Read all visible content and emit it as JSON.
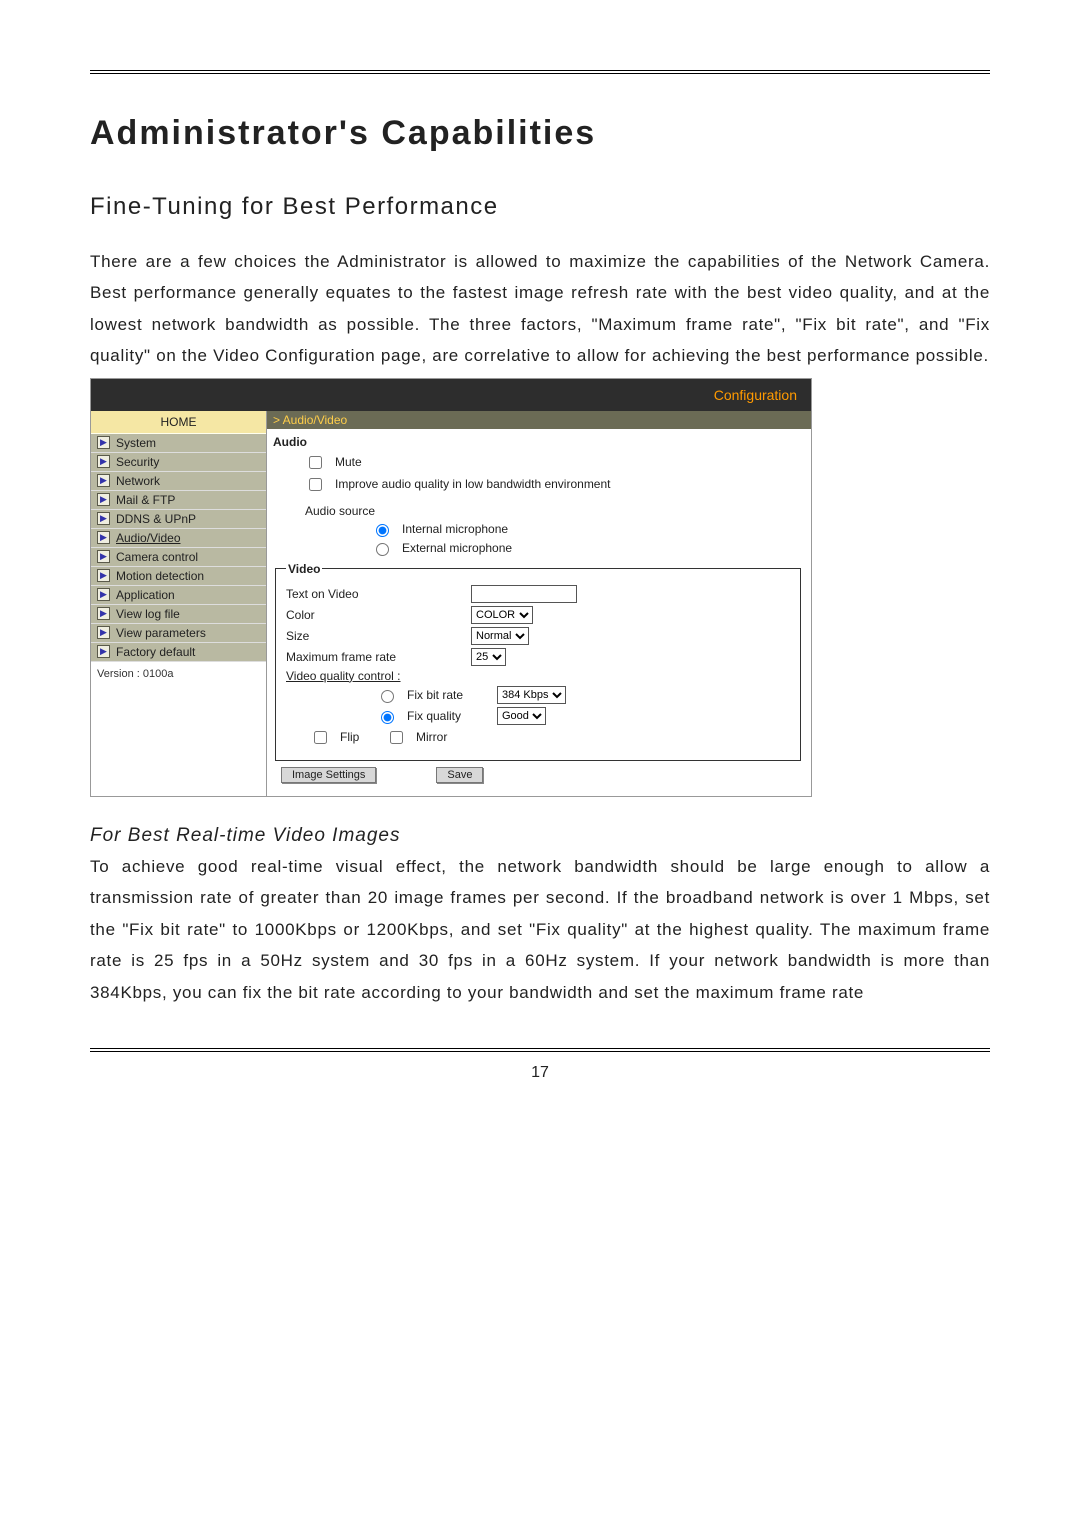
{
  "doc": {
    "h1": "Administrator's Capabilities",
    "h2": "Fine-Tuning for Best Performance",
    "p1": "There are a few choices the Administrator is allowed to maximize the capabilities of the Network Camera.  Best performance generally equates to the fastest image refresh rate with the best video quality, and at the lowest network bandwidth as possible. The three factors, \"Maximum frame rate\", \"Fix bit rate\", and \"Fix quality\" on the Video Configuration page, are correlative to allow for achieving the best performance possible.",
    "h3": "For Best Real-time Video Images",
    "p2": "To achieve good real-time visual effect, the network bandwidth should be large enough to allow a transmission rate of greater than 20 image frames per second.  If the broadband network is over 1 Mbps, set the \"Fix bit rate\" to 1000Kbps or 1200Kbps, and set \"Fix quality\" at the highest quality. The maximum frame rate is 25 fps in a 50Hz system and 30 fps in a 60Hz system. If your network bandwidth is more than 384Kbps, you can fix the bit rate according to your bandwidth and set the maximum frame rate",
    "page_number": "17"
  },
  "shot": {
    "config_label": "Configuration",
    "breadcrumb": "> Audio/Video",
    "home": "HOME",
    "sidebar": [
      "System",
      "Security",
      "Network",
      "Mail & FTP",
      "DDNS & UPnP",
      "Audio/Video",
      "Camera control",
      "Motion detection",
      "Application",
      "View log file",
      "View parameters",
      "Factory default"
    ],
    "version": "Version : 0100a",
    "audio": {
      "title": "Audio",
      "mute": "Mute",
      "improve": "Improve audio quality in low bandwidth environment",
      "source_label": "Audio source",
      "internal": "Internal microphone",
      "external": "External microphone"
    },
    "video": {
      "legend": "Video",
      "text_on_video_label": "Text on Video",
      "text_on_video_value": "",
      "color_label": "Color",
      "color_value": "COLOR",
      "size_label": "Size",
      "size_value": "Normal",
      "maxframe_label": "Maximum frame rate",
      "maxframe_value": "25",
      "quality_control": "Video quality control :",
      "fix_bit_rate_label": "Fix bit rate",
      "fix_bit_rate_value": "384 Kbps",
      "fix_quality_label": "Fix quality",
      "fix_quality_value": "Good",
      "flip": "Flip",
      "mirror": "Mirror",
      "image_settings_btn": "Image Settings",
      "save_btn": "Save"
    }
  }
}
